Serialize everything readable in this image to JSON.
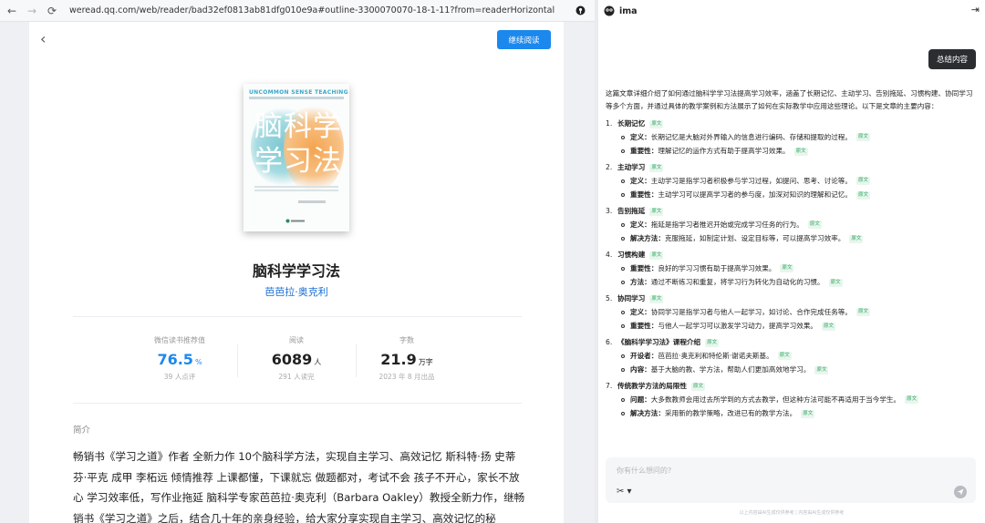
{
  "browser": {
    "url": "weread.qq.com/web/reader/bad32ef0813ab81dfg010e9a#outline-3300070070-18-1-11?from=readerHorizontal"
  },
  "reader": {
    "continue_label": "继续阅读",
    "cover": {
      "top_text": "UNCOMMON SENSE TEACHING",
      "title_line1": "脑科学",
      "title_line2": "学习法"
    },
    "title": "脑科学学习法",
    "author": "芭芭拉·奥克利",
    "stats": [
      {
        "label": "微信读书推荐值",
        "value": "76.5",
        "unit": "%",
        "note": "39 人点评"
      },
      {
        "label": "阅读",
        "value": "6089",
        "unit": "人",
        "note": "291 人读完"
      },
      {
        "label": "字数",
        "value": "21.9",
        "unit": "万字",
        "note": "2023 年 8 月出品"
      }
    ],
    "intro_label": "简介",
    "intro_text": "畅销书《学习之道》作者 全新力作 10个脑科学方法，实现自主学习、高效记忆 斯科特·扬 史蒂芬·平克 成甲 李柘远 倾情推荐 上课都懂，下课就忘 做题都对，考试不会 孩子不开心，家长不放心 学习效率低，写作业拖延 脑科学专家芭芭拉·奥克利（Barbara Oakley）教授全新力作，继畅销书《学习之道》之后，结合几十年的亲身经验，给大家分享实现自主学习、高效记忆的秘"
  },
  "ima": {
    "app_name": "ima",
    "summary_button": "总结内容",
    "source_tag": "原文",
    "intro": "这篇文章详细介绍了如何通过脑科学学习法提高学习效率，涵盖了长期记忆、主动学习、告别拖延、习惯构建、协同学习等多个方面，并通过具体的教学案例和方法展示了如何在实际教学中应用这些理论。以下是文章的主要内容：",
    "sections": [
      {
        "num": "1.",
        "title": "长期记忆",
        "bullets": [
          {
            "key": "定义：",
            "text": "长期记忆是大脑对外界输入的信息进行编码、存储和提取的过程。"
          },
          {
            "key": "重要性：",
            "text": "理解记忆的运作方式有助于提高学习效果。"
          }
        ]
      },
      {
        "num": "2.",
        "title": "主动学习",
        "bullets": [
          {
            "key": "定义：",
            "text": "主动学习是指学习者积极参与学习过程，如提问、思考、讨论等。"
          },
          {
            "key": "重要性：",
            "text": "主动学习可以提高学习者的参与度，加深对知识的理解和记忆。"
          }
        ]
      },
      {
        "num": "3.",
        "title": "告别拖延",
        "bullets": [
          {
            "key": "定义：",
            "text": "拖延是指学习者推迟开始或完成学习任务的行为。"
          },
          {
            "key": "解决方法：",
            "text": "克服拖延，如制定计划、设定目标等，可以提高学习效率。"
          }
        ]
      },
      {
        "num": "4.",
        "title": "习惯构建",
        "bullets": [
          {
            "key": "重要性：",
            "text": "良好的学习习惯有助于提高学习效果。"
          },
          {
            "key": "方法：",
            "text": "通过不断练习和重复，将学习行为转化为自动化的习惯。"
          }
        ]
      },
      {
        "num": "5.",
        "title": "协同学习",
        "bullets": [
          {
            "key": "定义：",
            "text": "协同学习是指学习者与他人一起学习，如讨论、合作完成任务等。"
          },
          {
            "key": "重要性：",
            "text": "与他人一起学习可以激发学习动力，提高学习效果。"
          }
        ]
      },
      {
        "num": "6.",
        "title": "《脑科学学习法》课程介绍",
        "bullets": [
          {
            "key": "开设者：",
            "text": "芭芭拉·奥克利和特伦斯·谢诺夫斯基。"
          },
          {
            "key": "内容：",
            "text": "基于大脑的教、学方法，帮助人们更加高效地学习。"
          }
        ]
      },
      {
        "num": "7.",
        "title": "传统教学方法的局限性",
        "bullets": [
          {
            "key": "问题：",
            "text": "大多数教师会用过去所学到的方式去教学，但这种方法可能不再适用于当今学生。"
          },
          {
            "key": "解决方法：",
            "text": "采用新的教学策略，改进已有的教学方法。"
          }
        ]
      }
    ],
    "input_placeholder": "你有什么想问的?",
    "footer": "以上内容由AI生成仅供参考 | 内容由AI生成仅供参考"
  }
}
